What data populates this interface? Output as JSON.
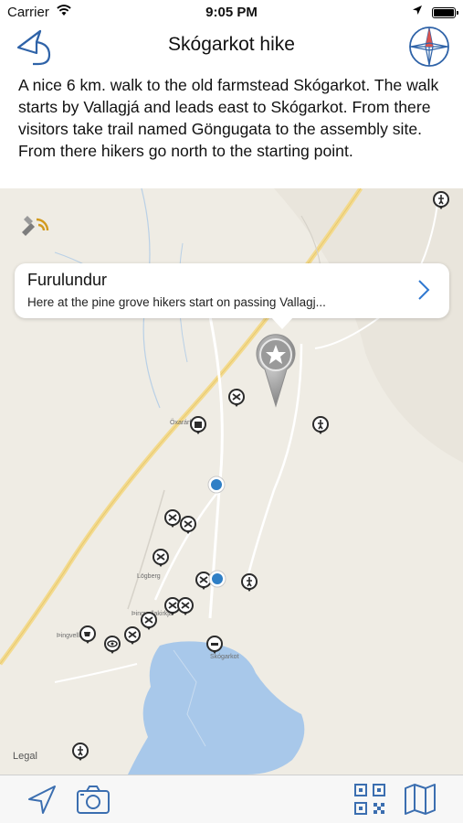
{
  "status_bar": {
    "carrier": "Carrier",
    "time": "9:05 PM"
  },
  "nav": {
    "title": "Skógarkot hike",
    "back_icon": "back-arrow-icon",
    "compass_icon": "compass-icon",
    "accent_color": "#2f63a8"
  },
  "description": "A nice 6 km. walk to the old farmstead Skógarkot. The walk starts by Vallagjá and leads east to Skógarkot. From there visitors take trail named Göngugata to the assembly site. From there hikers go north to the starting point.",
  "map": {
    "callout": {
      "title": "Furulundur",
      "subtitle": "Here at the pine grove hikers start on passing Vallagj..."
    },
    "legal": "Legal",
    "labels": [
      "Öxarárfoss",
      "Lögberg",
      "Þingvallakirkja",
      "Þingvellir",
      "Skógarkot"
    ],
    "lake_color": "#a8c8ea",
    "road_color": "#f3da8e"
  },
  "tabbar": {
    "icons": [
      "location-arrow-icon",
      "camera-icon",
      "qr-code-icon",
      "map-icon"
    ],
    "icon_color": "#3b6eb0"
  }
}
